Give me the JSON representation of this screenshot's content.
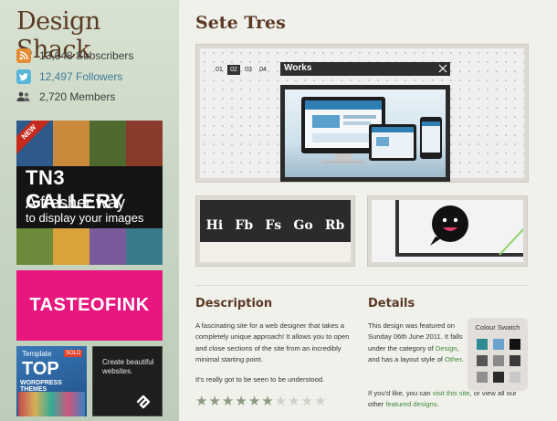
{
  "sidebar": {
    "logo": "Design Shack",
    "stats": [
      {
        "icon": "rss-icon",
        "text": "13,648 Subscribers"
      },
      {
        "icon": "twitter-icon",
        "text": "12,497 Followers"
      },
      {
        "icon": "members-icon",
        "text": "2,720 Members"
      }
    ],
    "ads": {
      "gallery": {
        "badge": "NEW",
        "brand": "TN3 GALLERY",
        "line1": "A fresher way",
        "line2": "to display your images"
      },
      "ink": {
        "text": "TASTEOFINK"
      },
      "template": {
        "line1": "Template",
        "sold": "SOLD",
        "line2": "TOP",
        "line3": "WORDPRESS THEMES"
      },
      "squarespace": {
        "text": "Create beautiful websites."
      }
    }
  },
  "main": {
    "title": "Sete Tres",
    "hero": {
      "pages": [
        "01",
        "02",
        "03",
        "04"
      ],
      "active_page": "02",
      "bar_label": "Works"
    },
    "thumb1_items": [
      "Hi",
      "Fb",
      "Fs",
      "Go",
      "Rb"
    ],
    "description": {
      "heading": "Description",
      "p1": "A fascinating site for a web designer that takes a completely unique approach! It allows you to open and close sections of the site from an incredibly minimal starting point.",
      "p2": "It's really got to be seen to be understood."
    },
    "rating": {
      "value": 6,
      "max": 10
    },
    "details": {
      "heading": "Details",
      "p1_a": "This design was featured on Sunday 06th June 2011. It falls under the category of ",
      "p1_link1": "Design",
      "p1_b": ", and has a layout style of ",
      "p1_link2": "Other",
      "p1_c": ".",
      "p2_a": "If you'd like, you can ",
      "p2_link1": "visit this site",
      "p2_b": ", or view all our other ",
      "p2_link2": "featured designs",
      "p2_c": "."
    },
    "swatch": {
      "title": "Colour Swatch",
      "colors": [
        "#2e8a93",
        "#6aa3cf",
        "#111111",
        "#555555",
        "#8a8a8a",
        "#3a3a3a",
        "#8f8f8f",
        "#2a2a2a",
        "#c9c9c9"
      ]
    }
  }
}
